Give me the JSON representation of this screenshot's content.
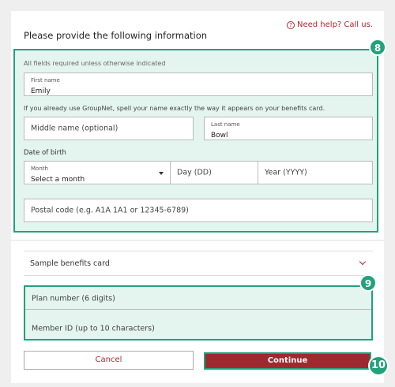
{
  "help_link": "Need help? Call us.",
  "heading": "Please provide the following information",
  "note_required": "All fields required unless otherwise indicated",
  "first_name": {
    "label": "First name",
    "value": "Emily"
  },
  "groupnet_note": "If you already use GroupNet, spell your name exactly the way it appears on your benefits card.",
  "middle_name": {
    "placeholder": "Middle name (optional)"
  },
  "last_name": {
    "label": "Last name",
    "value": "Bowl"
  },
  "dob_label": "Date of birth",
  "month": {
    "label": "Month",
    "value": "Select a month"
  },
  "day": {
    "placeholder": "Day (DD)"
  },
  "year": {
    "placeholder": "Year (YYYY)"
  },
  "postal": {
    "placeholder": "Postal code (e.g. A1A 1A1 or 12345-6789)"
  },
  "sample_card": "Sample benefits card",
  "plan_number": {
    "placeholder": "Plan number (6 digits)"
  },
  "member_id": {
    "placeholder": "Member ID (up to 10 characters)"
  },
  "buttons": {
    "cancel": "Cancel",
    "continue": "Continue"
  },
  "badges": {
    "form": "8",
    "ids": "9",
    "continue": "10"
  },
  "colors": {
    "accent": "#b7252e",
    "highlight": "#21a27a",
    "primary_button": "#9e2a2f"
  }
}
